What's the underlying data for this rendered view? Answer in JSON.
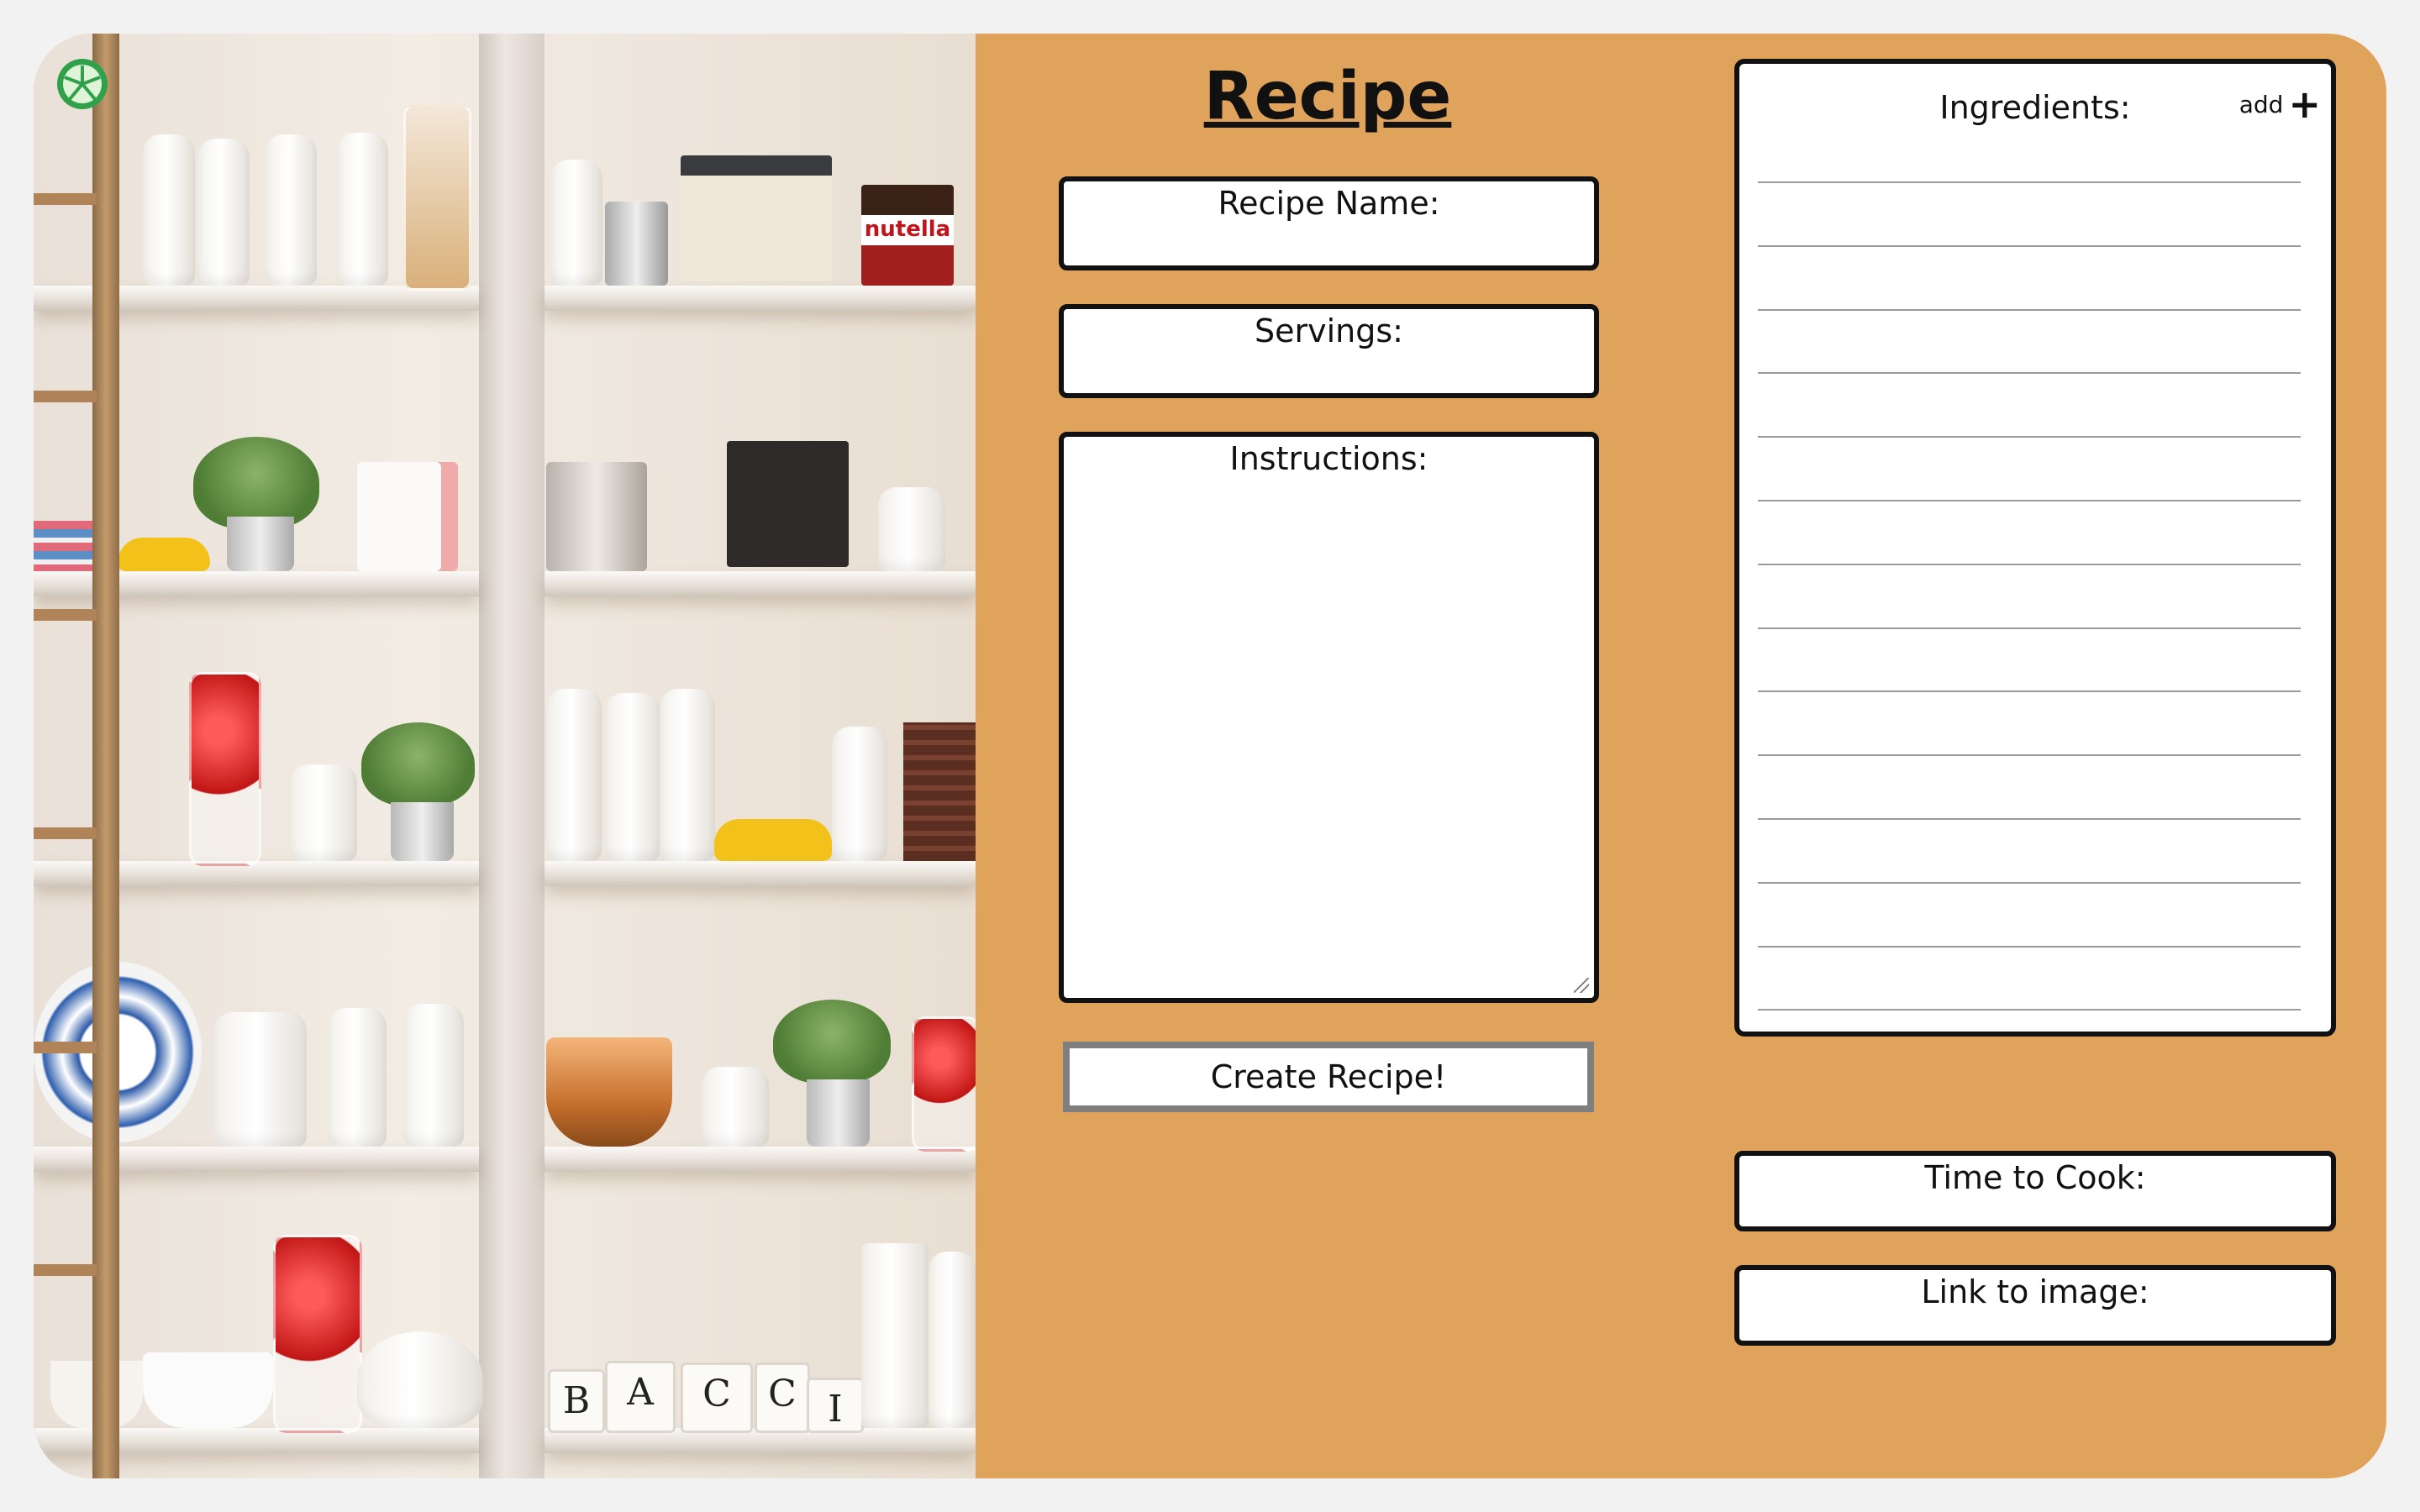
{
  "form": {
    "title": "Recipe",
    "recipe_name_label": "Recipe Name:",
    "servings_label": "Servings:",
    "instructions_label": "Instructions:",
    "create_button_label": "Create Recipe!",
    "time_to_cook_label": "Time to Cook:",
    "link_to_image_label": "Link to image:"
  },
  "ingredients": {
    "label": "Ingredients:",
    "add_label": "add",
    "add_icon": "plus-icon",
    "line_count": 14
  },
  "photo": {
    "mug_letters": [
      "B",
      "A",
      "C",
      "C",
      "I"
    ],
    "box_label": "nutella"
  },
  "colors": {
    "panel_background": "#e0a35c",
    "border": "#111111",
    "button_border": "#7f7f7f",
    "logo_green": "#2fa14a"
  }
}
